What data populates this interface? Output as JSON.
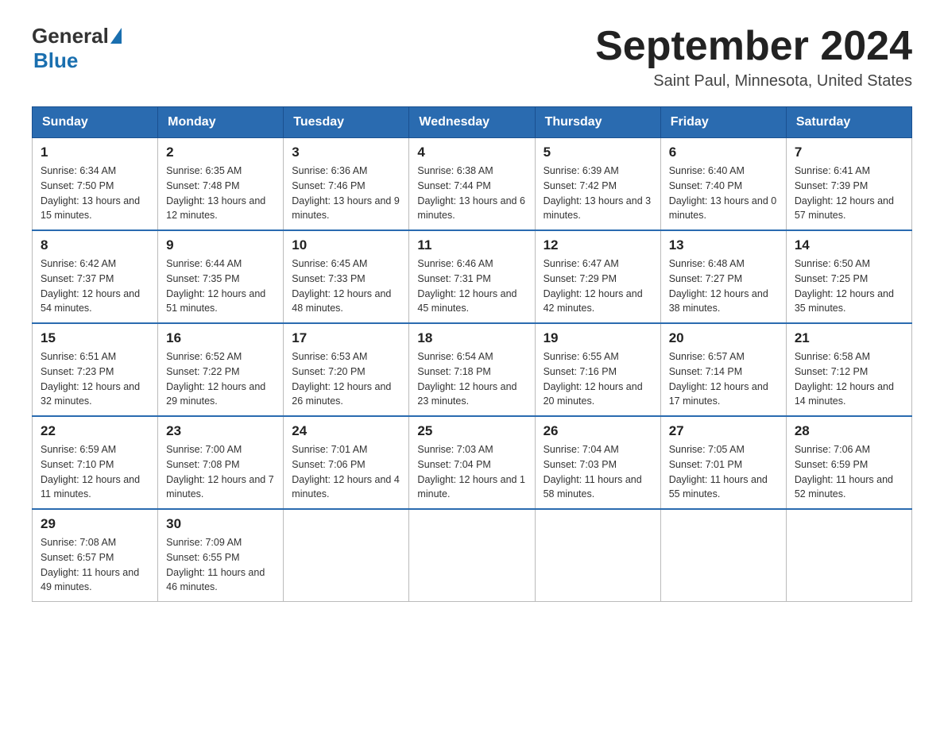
{
  "header": {
    "logo_general": "General",
    "logo_blue": "Blue",
    "month_title": "September 2024",
    "location": "Saint Paul, Minnesota, United States"
  },
  "weekdays": [
    "Sunday",
    "Monday",
    "Tuesday",
    "Wednesday",
    "Thursday",
    "Friday",
    "Saturday"
  ],
  "weeks": [
    [
      {
        "day": "1",
        "sunrise": "6:34 AM",
        "sunset": "7:50 PM",
        "daylight": "13 hours and 15 minutes."
      },
      {
        "day": "2",
        "sunrise": "6:35 AM",
        "sunset": "7:48 PM",
        "daylight": "13 hours and 12 minutes."
      },
      {
        "day": "3",
        "sunrise": "6:36 AM",
        "sunset": "7:46 PM",
        "daylight": "13 hours and 9 minutes."
      },
      {
        "day": "4",
        "sunrise": "6:38 AM",
        "sunset": "7:44 PM",
        "daylight": "13 hours and 6 minutes."
      },
      {
        "day": "5",
        "sunrise": "6:39 AM",
        "sunset": "7:42 PM",
        "daylight": "13 hours and 3 minutes."
      },
      {
        "day": "6",
        "sunrise": "6:40 AM",
        "sunset": "7:40 PM",
        "daylight": "13 hours and 0 minutes."
      },
      {
        "day": "7",
        "sunrise": "6:41 AM",
        "sunset": "7:39 PM",
        "daylight": "12 hours and 57 minutes."
      }
    ],
    [
      {
        "day": "8",
        "sunrise": "6:42 AM",
        "sunset": "7:37 PM",
        "daylight": "12 hours and 54 minutes."
      },
      {
        "day": "9",
        "sunrise": "6:44 AM",
        "sunset": "7:35 PM",
        "daylight": "12 hours and 51 minutes."
      },
      {
        "day": "10",
        "sunrise": "6:45 AM",
        "sunset": "7:33 PM",
        "daylight": "12 hours and 48 minutes."
      },
      {
        "day": "11",
        "sunrise": "6:46 AM",
        "sunset": "7:31 PM",
        "daylight": "12 hours and 45 minutes."
      },
      {
        "day": "12",
        "sunrise": "6:47 AM",
        "sunset": "7:29 PM",
        "daylight": "12 hours and 42 minutes."
      },
      {
        "day": "13",
        "sunrise": "6:48 AM",
        "sunset": "7:27 PM",
        "daylight": "12 hours and 38 minutes."
      },
      {
        "day": "14",
        "sunrise": "6:50 AM",
        "sunset": "7:25 PM",
        "daylight": "12 hours and 35 minutes."
      }
    ],
    [
      {
        "day": "15",
        "sunrise": "6:51 AM",
        "sunset": "7:23 PM",
        "daylight": "12 hours and 32 minutes."
      },
      {
        "day": "16",
        "sunrise": "6:52 AM",
        "sunset": "7:22 PM",
        "daylight": "12 hours and 29 minutes."
      },
      {
        "day": "17",
        "sunrise": "6:53 AM",
        "sunset": "7:20 PM",
        "daylight": "12 hours and 26 minutes."
      },
      {
        "day": "18",
        "sunrise": "6:54 AM",
        "sunset": "7:18 PM",
        "daylight": "12 hours and 23 minutes."
      },
      {
        "day": "19",
        "sunrise": "6:55 AM",
        "sunset": "7:16 PM",
        "daylight": "12 hours and 20 minutes."
      },
      {
        "day": "20",
        "sunrise": "6:57 AM",
        "sunset": "7:14 PM",
        "daylight": "12 hours and 17 minutes."
      },
      {
        "day": "21",
        "sunrise": "6:58 AM",
        "sunset": "7:12 PM",
        "daylight": "12 hours and 14 minutes."
      }
    ],
    [
      {
        "day": "22",
        "sunrise": "6:59 AM",
        "sunset": "7:10 PM",
        "daylight": "12 hours and 11 minutes."
      },
      {
        "day": "23",
        "sunrise": "7:00 AM",
        "sunset": "7:08 PM",
        "daylight": "12 hours and 7 minutes."
      },
      {
        "day": "24",
        "sunrise": "7:01 AM",
        "sunset": "7:06 PM",
        "daylight": "12 hours and 4 minutes."
      },
      {
        "day": "25",
        "sunrise": "7:03 AM",
        "sunset": "7:04 PM",
        "daylight": "12 hours and 1 minute."
      },
      {
        "day": "26",
        "sunrise": "7:04 AM",
        "sunset": "7:03 PM",
        "daylight": "11 hours and 58 minutes."
      },
      {
        "day": "27",
        "sunrise": "7:05 AM",
        "sunset": "7:01 PM",
        "daylight": "11 hours and 55 minutes."
      },
      {
        "day": "28",
        "sunrise": "7:06 AM",
        "sunset": "6:59 PM",
        "daylight": "11 hours and 52 minutes."
      }
    ],
    [
      {
        "day": "29",
        "sunrise": "7:08 AM",
        "sunset": "6:57 PM",
        "daylight": "11 hours and 49 minutes."
      },
      {
        "day": "30",
        "sunrise": "7:09 AM",
        "sunset": "6:55 PM",
        "daylight": "11 hours and 46 minutes."
      },
      null,
      null,
      null,
      null,
      null
    ]
  ]
}
